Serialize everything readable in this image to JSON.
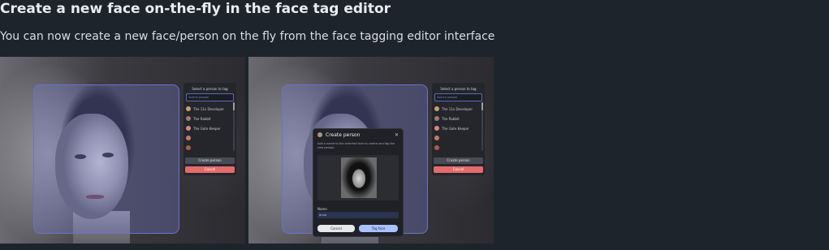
{
  "heading": "Create a new face on-the-fly in the face tag editor",
  "description": "You can now create a new face/person on the fly from the face tagging editor interface",
  "tag_panel": {
    "title": "Select a person to tag",
    "search_placeholder": "Search people",
    "people": [
      {
        "name": "The 11x Developer",
        "color": "#c9a071"
      },
      {
        "name": "The Rabbit",
        "color": "#9b7b6b"
      },
      {
        "name": "The Gate Keeper",
        "color": "#d9887f"
      },
      {
        "name": "",
        "color": "#c77b62"
      },
      {
        "name": "",
        "color": "#b05a45"
      }
    ],
    "create_label": "Create person",
    "cancel_label": "Cancel"
  },
  "dialog": {
    "title": "Create person",
    "close": "✕",
    "hint": "Add a name to the selected face to create and tag the new person.",
    "name_label": "Name",
    "name_value": "Anna",
    "cancel_label": "Cancel",
    "tag_label": "Tag face"
  }
}
